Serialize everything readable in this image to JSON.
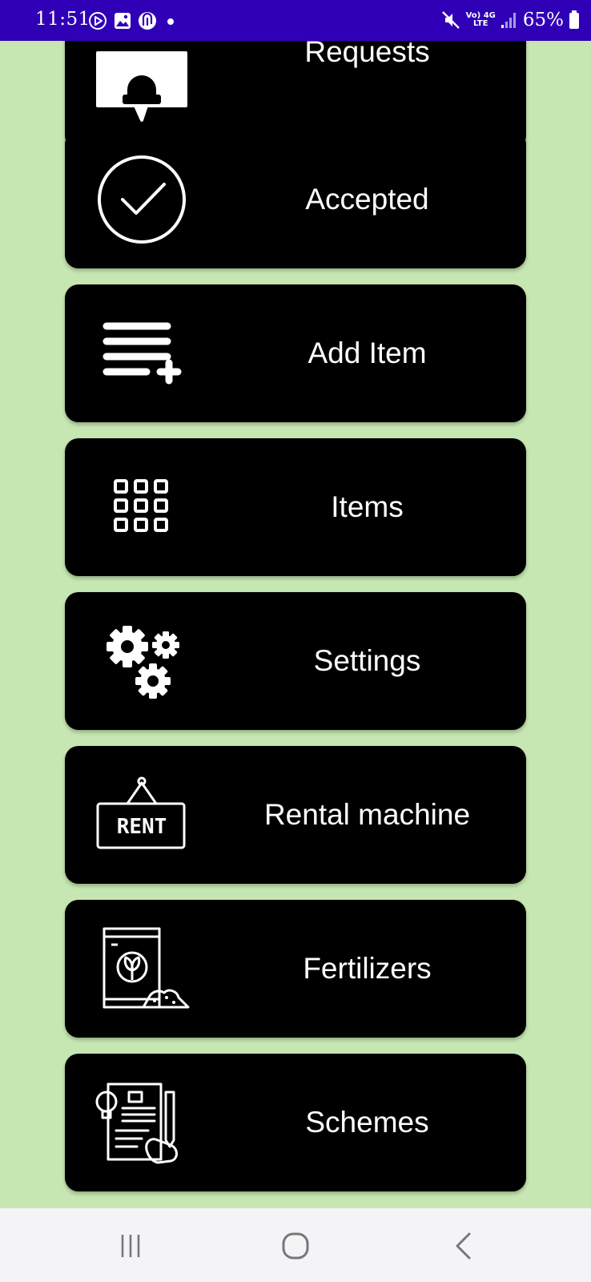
{
  "status_bar": {
    "time": "11:51",
    "battery_percent": "65%",
    "network_top": "Vo) 4G",
    "network_bottom": "LTE",
    "icons": [
      "screen-share-icon",
      "gallery-icon",
      "app-notification-icon",
      "dot-icon",
      "mute-icon",
      "signal-icon",
      "battery-icon"
    ]
  },
  "menu": {
    "items": [
      {
        "label": "Requests",
        "icon": "requests-icon"
      },
      {
        "label": "Accepted",
        "icon": "check-circle-icon"
      },
      {
        "label": "Add Item",
        "icon": "add-list-icon"
      },
      {
        "label": "Items",
        "icon": "grid-icon"
      },
      {
        "label": "Settings",
        "icon": "gears-icon"
      },
      {
        "label": "Rental machine",
        "icon": "rent-sign-icon"
      },
      {
        "label": "Fertilizers",
        "icon": "fertilizer-bag-icon"
      },
      {
        "label": "Schemes",
        "icon": "schemes-document-icon"
      }
    ]
  },
  "rent_sign_text": "RENT",
  "nav_bar": {
    "buttons": [
      "recent-apps-icon",
      "home-icon",
      "back-icon"
    ]
  },
  "colors": {
    "background": "#c7e7b2",
    "status_bar": "#3000b7",
    "card": "#000000",
    "nav_bar": "#f4f4f6"
  }
}
